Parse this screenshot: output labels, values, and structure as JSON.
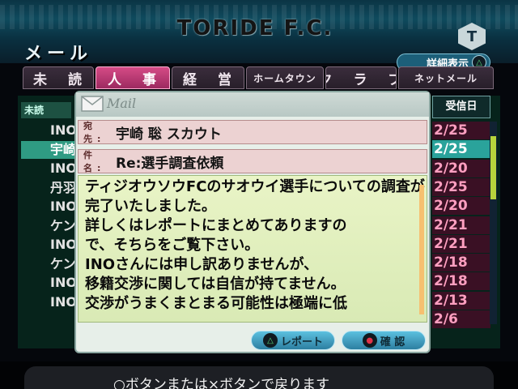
{
  "header": {
    "team_name": "TORIDE F.C.",
    "screen_title": "メール",
    "badge": "T",
    "detail_button": "詳細表示",
    "detail_button_mark": "△"
  },
  "tabs": [
    "未 読",
    "人 事",
    "経 営",
    "ホームタウン",
    "ク ラ ブ",
    "ネットメール"
  ],
  "active_tab": 1,
  "list": {
    "column_unread": "未読",
    "column_date": "受信日",
    "senders": [
      "INO",
      "宇崎",
      "INO",
      "丹羽",
      "INO",
      "ケンデ",
      "INO",
      "ケンデ",
      "INO",
      "INO"
    ],
    "dates": [
      "2/25",
      "2/25",
      "2/20",
      "2/25",
      "2/20",
      "2/21",
      "2/21",
      "2/18",
      "2/18",
      "2/13",
      "2/6"
    ],
    "selected_index": 1
  },
  "mail": {
    "logo": "Mail",
    "from_label": "宛 先:",
    "from": "宇崎 聡 スカウト",
    "subject_label": "件 名:",
    "subject": "Re:選手調査依頼",
    "body": "ティジオウソウFCのサオウイ選手についての調査が\n完了いたしました。\n詳しくはレポートにまとめてありますの\nで、そちらをご覧下さい。\nINOさんには申し訳ありませんが、\n移籍交渉に関しては自信が持てません。\n交渉がうまくまとまる可能性は極端に低"
  },
  "buttons": {
    "report_mark": "△",
    "report": "レポート",
    "confirm_mark": "●",
    "confirm": "確 認"
  },
  "footer": {
    "hint": "○ボタンまたは×ボタンで戻ります"
  },
  "colors": {
    "active_tab": "#c8417a",
    "selected_row": "#2f9b83",
    "date_text": "#ff9fc0"
  }
}
